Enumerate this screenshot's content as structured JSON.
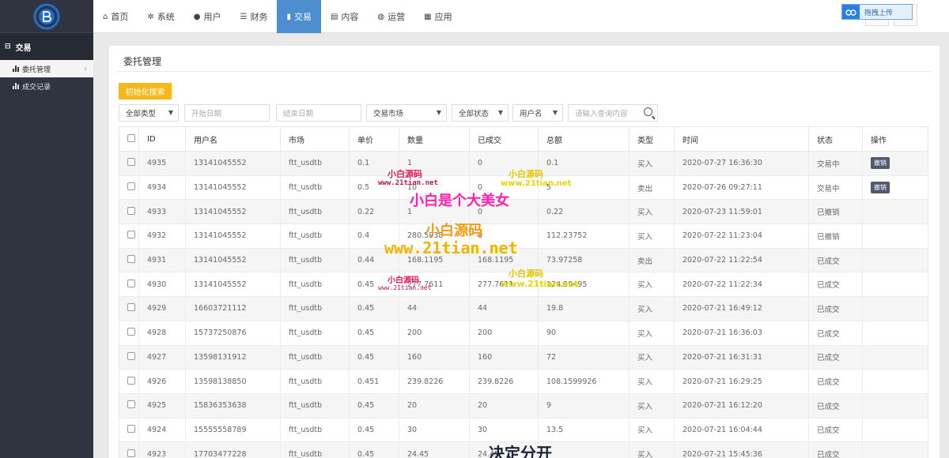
{
  "colors": {
    "sidebar": "#2f3440",
    "nav_active": "#4d8ed1",
    "init_button": "#f4b81d",
    "cancel_button": "#4f5a6e",
    "logo": "#1f6fd1"
  },
  "sidebar": {
    "section": "交易",
    "items": [
      {
        "label": "委托管理",
        "active": true
      },
      {
        "label": "成交记录",
        "active": false
      }
    ]
  },
  "topnav": {
    "items": [
      {
        "label": "首页",
        "icon": "home-icon"
      },
      {
        "label": "系统",
        "icon": "gear-icon"
      },
      {
        "label": "用户",
        "icon": "user-icon"
      },
      {
        "label": "财务",
        "icon": "list-icon"
      },
      {
        "label": "交易",
        "icon": "bar-chart-icon",
        "active": true
      },
      {
        "label": "内容",
        "icon": "document-icon"
      },
      {
        "label": "运营",
        "icon": "globe-icon"
      },
      {
        "label": "应用",
        "icon": "grid-icon"
      }
    ],
    "upload_label": "拖拽上传"
  },
  "page": {
    "title": "委托管理",
    "init_button": "初始化搜索"
  },
  "filters": {
    "type": "全部类型",
    "start_date": "开始日期",
    "end_date": "结束日期",
    "market": "交易市场",
    "status": "全部状态",
    "user": "用户名",
    "search_placeholder": "请输入查询内容"
  },
  "table": {
    "headers": [
      "ID",
      "用户名",
      "市场",
      "单价",
      "数量",
      "已成交",
      "总额",
      "类型",
      "时间",
      "状态",
      "操作"
    ],
    "rows": [
      {
        "id": "4935",
        "user": "13141045552",
        "market": "ftt_usdtb",
        "price": "0.1",
        "qty": "1",
        "filled": "0",
        "total": "0.1",
        "type": "买入",
        "time": "2020-07-27 16:36:30",
        "status": "交易中",
        "action": "撤销"
      },
      {
        "id": "4934",
        "user": "13141045552",
        "market": "ftt_usdtb",
        "price": "0.5",
        "qty": "10",
        "filled": "0",
        "total": "5",
        "type": "卖出",
        "time": "2020-07-26 09:27:11",
        "status": "交易中",
        "action": "撤销"
      },
      {
        "id": "4933",
        "user": "13141045552",
        "market": "ftt_usdtb",
        "price": "0.22",
        "qty": "1",
        "filled": "0",
        "total": "0.22",
        "type": "买入",
        "time": "2020-07-23 11:59:01",
        "status": "已撤销",
        "action": ""
      },
      {
        "id": "4932",
        "user": "13141045552",
        "market": "ftt_usdtb",
        "price": "0.4",
        "qty": "280.5938",
        "filled": "0",
        "total": "112.23752",
        "type": "买入",
        "time": "2020-07-22 11:23:04",
        "status": "已撤销",
        "action": ""
      },
      {
        "id": "4931",
        "user": "13141045552",
        "market": "ftt_usdtb",
        "price": "0.44",
        "qty": "168.1195",
        "filled": "168.1195",
        "total": "73.97258",
        "type": "卖出",
        "time": "2020-07-22 11:22:54",
        "status": "已成交",
        "action": ""
      },
      {
        "id": "4930",
        "user": "13141045552",
        "market": "ftt_usdtb",
        "price": "0.45",
        "qty": "277.7611",
        "filled": "277.7611",
        "total": "124.99495",
        "type": "买入",
        "time": "2020-07-22 11:22:34",
        "status": "已成交",
        "action": ""
      },
      {
        "id": "4929",
        "user": "16603721112",
        "market": "ftt_usdtb",
        "price": "0.45",
        "qty": "44",
        "filled": "44",
        "total": "19.8",
        "type": "买入",
        "time": "2020-07-21 16:49:12",
        "status": "已成交",
        "action": ""
      },
      {
        "id": "4928",
        "user": "15737250876",
        "market": "ftt_usdtb",
        "price": "0.45",
        "qty": "200",
        "filled": "200",
        "total": "90",
        "type": "买入",
        "time": "2020-07-21 16:36:03",
        "status": "已成交",
        "action": ""
      },
      {
        "id": "4927",
        "user": "13598131912",
        "market": "ftt_usdtb",
        "price": "0.45",
        "qty": "160",
        "filled": "160",
        "total": "72",
        "type": "买入",
        "time": "2020-07-21 16:31:31",
        "status": "已成交",
        "action": ""
      },
      {
        "id": "4926",
        "user": "13598138850",
        "market": "ftt_usdtb",
        "price": "0.451",
        "qty": "239.8226",
        "filled": "239.8226",
        "total": "108.1599926",
        "type": "买入",
        "time": "2020-07-21 16:29:25",
        "status": "已成交",
        "action": ""
      },
      {
        "id": "4925",
        "user": "15836353638",
        "market": "ftt_usdtb",
        "price": "0.45",
        "qty": "20",
        "filled": "20",
        "total": "9",
        "type": "买入",
        "time": "2020-07-21 16:12:20",
        "status": "已成交",
        "action": ""
      },
      {
        "id": "4924",
        "user": "15555558789",
        "market": "ftt_usdtb",
        "price": "0.45",
        "qty": "30",
        "filled": "30",
        "total": "13.5",
        "type": "买入",
        "time": "2020-07-21 16:04:44",
        "status": "已成交",
        "action": ""
      },
      {
        "id": "4923",
        "user": "17703477228",
        "market": "ftt_usdtb",
        "price": "0.45",
        "qty": "24.45",
        "filled": "24.45",
        "total": "",
        "type": "买入",
        "time": "2020-07-21 15:45:36",
        "status": "已成交",
        "action": ""
      }
    ]
  },
  "watermarks": {
    "a1": "小白源码",
    "a2": "www.21tian.net",
    "b1": "小白源码",
    "b2": "www.21tian.net",
    "big1": "小白是个大美女",
    "big2": "小白源码",
    "big3": "www.21tian.net",
    "c1": "小白源码",
    "c2": "www.21tian.net",
    "d1": "小白源码",
    "d2": "www.21tian.net",
    "bottom": "决定分开"
  }
}
